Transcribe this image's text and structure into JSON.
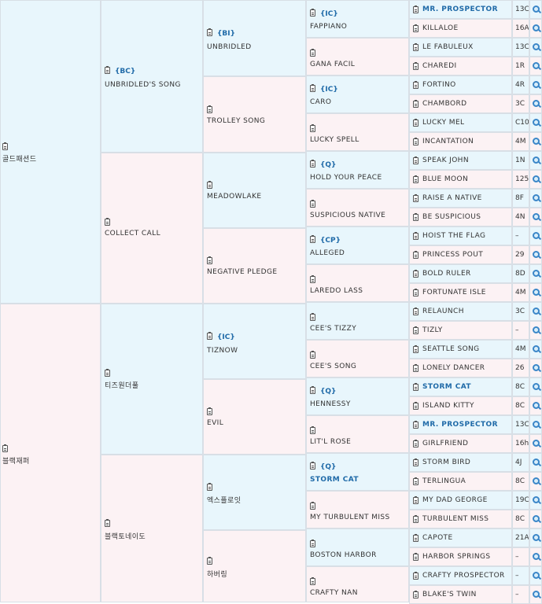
{
  "pedigree": {
    "gen1": [
      {
        "name": "골드패션드",
        "tag": ""
      },
      {
        "name": "블랙재퍼",
        "tag": ""
      }
    ],
    "gen2": [
      {
        "name": "UNBRIDLED'S SONG",
        "tag": "{BC}"
      },
      {
        "name": "COLLECT CALL",
        "tag": ""
      },
      {
        "name": "티즈원더풀",
        "tag": ""
      },
      {
        "name": "블랙토네이도",
        "tag": ""
      }
    ],
    "gen3": [
      {
        "name": "UNBRIDLED",
        "tag": "{BI}"
      },
      {
        "name": "TROLLEY SONG",
        "tag": ""
      },
      {
        "name": "MEADOWLAKE",
        "tag": ""
      },
      {
        "name": "NEGATIVE PLEDGE",
        "tag": ""
      },
      {
        "name": "TIZNOW",
        "tag": "{IC}"
      },
      {
        "name": "EVIL",
        "tag": ""
      },
      {
        "name": "엑스플로잇",
        "tag": ""
      },
      {
        "name": "하버링",
        "tag": ""
      }
    ],
    "gen4": [
      {
        "name": "FAPPIANO",
        "tag": "{IC}"
      },
      {
        "name": "GANA FACIL",
        "tag": ""
      },
      {
        "name": "CARO",
        "tag": "{IC}"
      },
      {
        "name": "LUCKY SPELL",
        "tag": ""
      },
      {
        "name": "HOLD YOUR PEACE",
        "tag": "{Q}"
      },
      {
        "name": "SUSPICIOUS NATIVE",
        "tag": ""
      },
      {
        "name": "ALLEGED",
        "tag": "{CP}"
      },
      {
        "name": "LAREDO LASS",
        "tag": ""
      },
      {
        "name": "CEE'S TIZZY",
        "tag": ""
      },
      {
        "name": "CEE'S SONG",
        "tag": ""
      },
      {
        "name": "HENNESSY",
        "tag": "{Q}"
      },
      {
        "name": "LIT'L ROSE",
        "tag": ""
      },
      {
        "name": "STORM CAT",
        "tag": "{Q}"
      },
      {
        "name": "MY TURBULENT MISS",
        "tag": ""
      },
      {
        "name": "BOSTON HARBOR",
        "tag": ""
      },
      {
        "name": "CRAFTY NAN",
        "tag": ""
      }
    ],
    "gen5": [
      {
        "name": "MR. PROSPECTOR",
        "num": "13C"
      },
      {
        "name": "KILLALOE",
        "num": "16A"
      },
      {
        "name": "LE FABULEUX",
        "num": "13C"
      },
      {
        "name": "CHAREDI",
        "num": "1R"
      },
      {
        "name": "FORTINO",
        "num": "4R"
      },
      {
        "name": "CHAMBORD",
        "num": "3C"
      },
      {
        "name": "LUCKY MEL",
        "num": "C10"
      },
      {
        "name": "INCANTATION",
        "num": "4M"
      },
      {
        "name": "SPEAK JOHN",
        "num": "1N"
      },
      {
        "name": "BLUE MOON",
        "num": "125"
      },
      {
        "name": "RAISE A NATIVE",
        "num": "8F"
      },
      {
        "name": "BE SUSPICIOUS",
        "num": "4N"
      },
      {
        "name": "HOIST THE FLAG",
        "num": "–"
      },
      {
        "name": "PRINCESS POUT",
        "num": "29"
      },
      {
        "name": "BOLD RULER",
        "num": "8D"
      },
      {
        "name": "FORTUNATE ISLE",
        "num": "4M"
      },
      {
        "name": "RELAUNCH",
        "num": "3C"
      },
      {
        "name": "TIZLY",
        "num": "–"
      },
      {
        "name": "SEATTLE SONG",
        "num": "4M"
      },
      {
        "name": "LONELY DANCER",
        "num": "26"
      },
      {
        "name": "STORM CAT",
        "num": "8C"
      },
      {
        "name": "ISLAND KITTY",
        "num": "8C"
      },
      {
        "name": "MR. PROSPECTOR",
        "num": "13C"
      },
      {
        "name": "GIRLFRIEND",
        "num": "16h"
      },
      {
        "name": "STORM BIRD",
        "num": "4J"
      },
      {
        "name": "TERLINGUA",
        "num": "8C"
      },
      {
        "name": "MY DAD GEORGE",
        "num": "19C"
      },
      {
        "name": "TURBULENT MISS",
        "num": "8C"
      },
      {
        "name": "CAPOTE",
        "num": "21A"
      },
      {
        "name": "HARBOR SPRINGS",
        "num": "–"
      },
      {
        "name": "CRAFTY PROSPECTOR",
        "num": "–"
      },
      {
        "name": "BLAKE'S TWIN",
        "num": "–"
      }
    ]
  }
}
